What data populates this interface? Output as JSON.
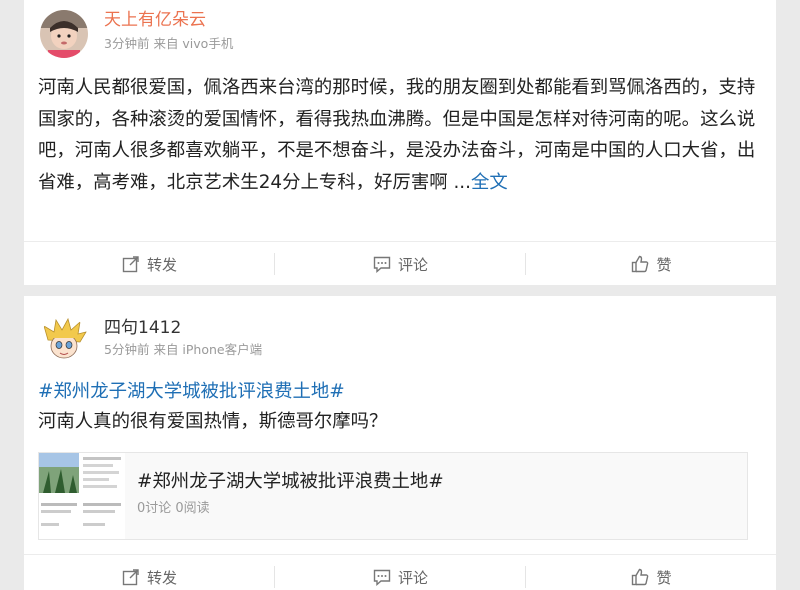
{
  "posts": [
    {
      "username": "天上有亿朵云",
      "username_color": "#eb7350",
      "time": "3分钟前",
      "source": "来自 vivo手机",
      "text": "河南人民都很爱国，佩洛西来台湾的那时候，我的朋友圈到处都能看到骂佩洛西的，支持国家的，各种滚烫的爱国情怀，看得我热血沸腾。但是中国是怎样对待河南的呢。这么说吧，河南人很多都喜欢躺平，不是不想奋斗，是没办法奋斗，河南是中国的人口大省，出省难，高考难，北京艺术生24分上专科，好厉害啊 ...",
      "more_label": "全文",
      "actions": {
        "repost": "转发",
        "comment": "评论",
        "like": "赞"
      }
    },
    {
      "username": "四句1412",
      "username_color": "#333333",
      "time": "5分钟前",
      "source": "来自 iPhone客户端",
      "topic": "#郑州龙子湖大学城被批评浪费土地#",
      "text": "河南人真的很有爱国热情，斯德哥尔摩吗？",
      "share": {
        "title": "#郑州龙子湖大学城被批评浪费土地#",
        "stats": "0讨论 0阅读"
      },
      "actions": {
        "repost": "转发",
        "comment": "评论",
        "like": "赞"
      }
    }
  ],
  "colors": {
    "link": "#1f6fb5",
    "meta": "#9a9a9a",
    "page_bg": "#eaeaea"
  },
  "icons": [
    "repost-icon",
    "comment-icon",
    "like-icon"
  ]
}
